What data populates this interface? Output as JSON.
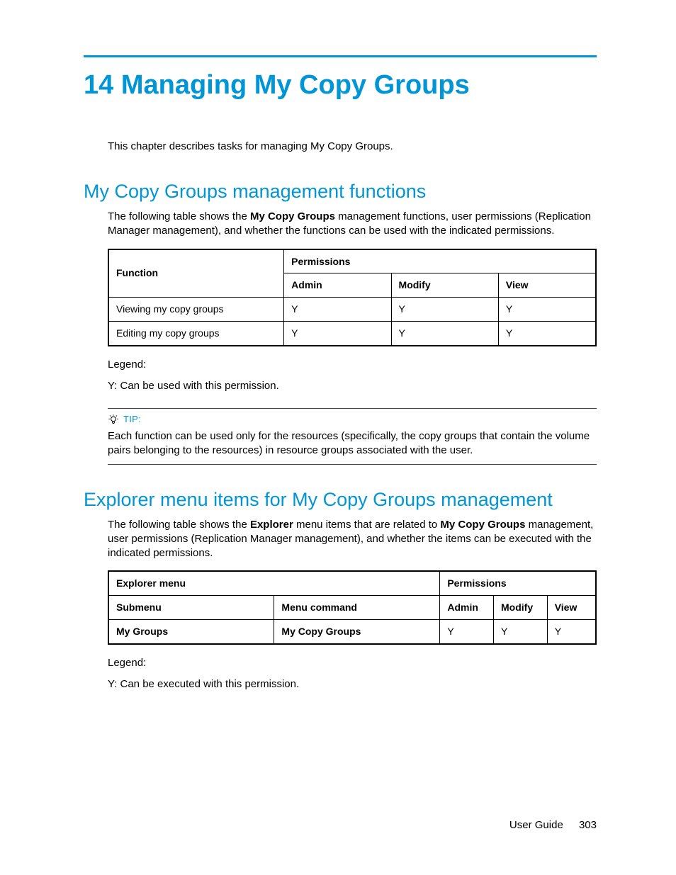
{
  "accent_color": "#0096d6",
  "chapter": {
    "number": "14",
    "title_full": "14 Managing My Copy Groups",
    "intro": "This chapter describes tasks for managing My Copy Groups."
  },
  "section1": {
    "title": "My Copy Groups management functions",
    "para_parts": {
      "pre": "The following table shows the ",
      "bold1": "My Copy Groups",
      "post": " management functions, user permissions (Replication Manager management), and whether the functions can be used with the indicated permissions."
    },
    "table": {
      "headers": {
        "function": "Function",
        "permissions": "Permissions",
        "admin": "Admin",
        "modify": "Modify",
        "view": "View"
      },
      "rows": [
        {
          "function": "Viewing my copy groups",
          "admin": "Y",
          "modify": "Y",
          "view": "Y"
        },
        {
          "function": "Editing my copy groups",
          "admin": "Y",
          "modify": "Y",
          "view": "Y"
        }
      ]
    },
    "legend_label": "Legend:",
    "legend_line": "Y: Can be used with this permission."
  },
  "tip": {
    "label": "TIP:",
    "body": "Each function can be used only for the resources (specifically, the copy groups that contain the volume pairs belonging to the resources) in resource groups associated with the user."
  },
  "section2": {
    "title": "Explorer menu items for My Copy Groups management",
    "para_parts": {
      "pre": "The following table shows the ",
      "bold1": "Explorer",
      "mid": " menu items that are related to ",
      "bold2": "My Copy Groups",
      "post": " management, user permissions (Replication Manager management), and whether the items can be executed with the indicated permissions."
    },
    "table": {
      "headers": {
        "explorer_menu": "Explorer menu",
        "permissions": "Permissions",
        "submenu": "Submenu",
        "menu_command": "Menu command",
        "admin": "Admin",
        "modify": "Modify",
        "view": "View"
      },
      "rows": [
        {
          "submenu": "My Groups",
          "menu_command": "My Copy Groups",
          "admin": "Y",
          "modify": "Y",
          "view": "Y"
        }
      ]
    },
    "legend_label": "Legend:",
    "legend_line": "Y: Can be executed with this permission."
  },
  "footer": {
    "doc": "User Guide",
    "page": "303"
  }
}
